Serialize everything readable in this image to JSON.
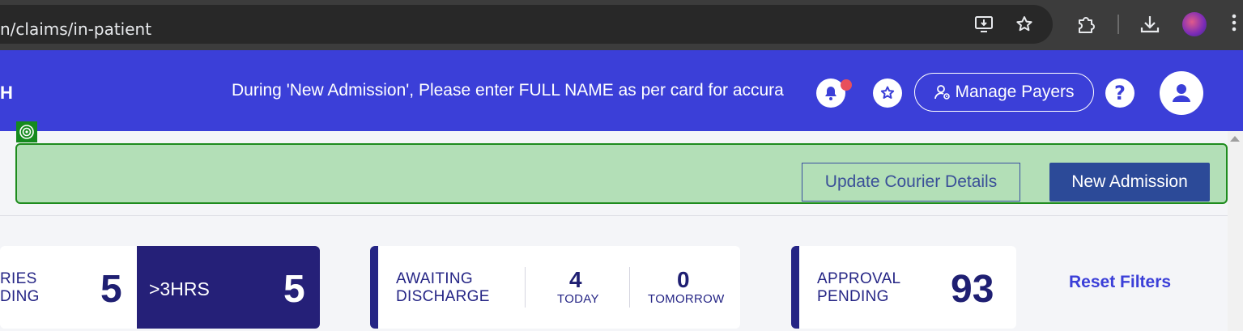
{
  "browser": {
    "url": "n/claims/in-patient",
    "icons": [
      "install-app-icon",
      "bookmark-star-icon",
      "extensions-icon",
      "downloads-icon",
      "profile-avatar",
      "more-menu-icon"
    ]
  },
  "header": {
    "brand": "H",
    "announcement": "During 'New Admission', Please enter FULL NAME as per card for accura",
    "manage_payers_label": "Manage Payers",
    "colors": {
      "header_bg": "#3b3fd8",
      "notification_dot": "#e8505b"
    }
  },
  "actions": {
    "update_courier_label": "Update Courier Details",
    "new_admission_label": "New Admission",
    "colors": {
      "band_bg": "#b3dfb7",
      "band_border": "#1e8c1e",
      "primary_button": "#2c4a98"
    }
  },
  "stats": {
    "queries": {
      "label_line1": "RIES",
      "label_line2": "DING",
      "count": "5",
      "over_label": ">3HRS",
      "over_count": "5"
    },
    "discharge": {
      "label_line1": "AWAITING",
      "label_line2": "DISCHARGE",
      "today_count": "4",
      "today_label": "TODAY",
      "tomorrow_count": "0",
      "tomorrow_label": "TOMORROW"
    },
    "approval": {
      "label_line1": "APPROVAL",
      "label_line2": "PENDING",
      "count": "93"
    },
    "reset_label": "Reset Filters",
    "colors": {
      "accent": "#252585",
      "dark_block": "#252078",
      "link": "#3b3fd8"
    }
  }
}
